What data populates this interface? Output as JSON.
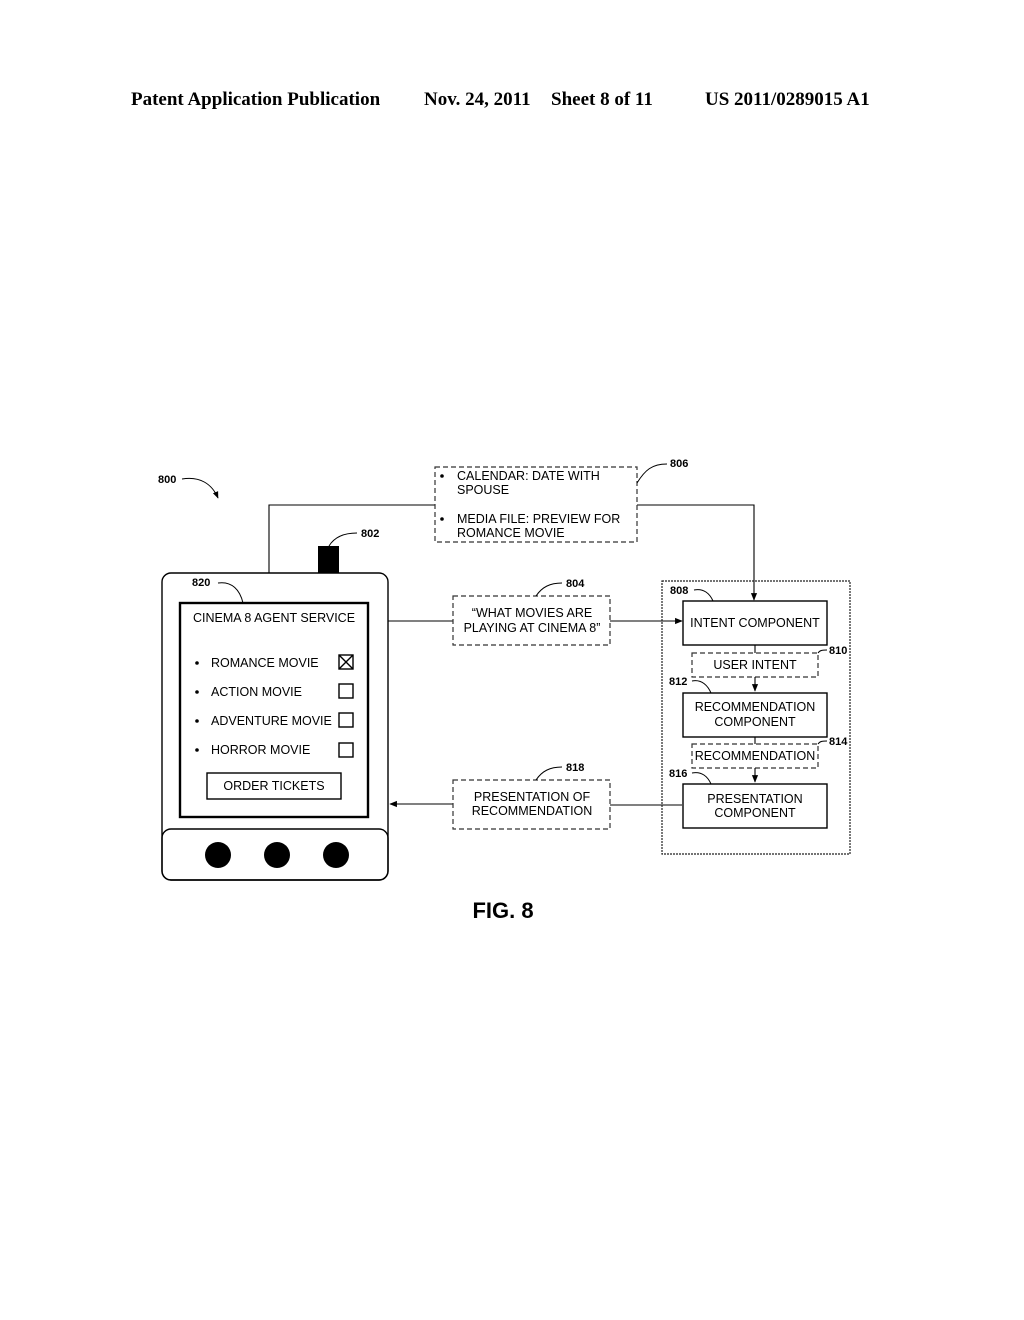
{
  "header": {
    "left": "Patent Application Publication",
    "date": "Nov. 24, 2011",
    "sheet": "Sheet 8 of 11",
    "number": "US 2011/0289015 A1"
  },
  "figure": {
    "caption": "FIG. 8",
    "system_ref": "800",
    "sensor": {
      "ref": "802"
    },
    "device": {
      "screen_ref": "820",
      "screen_title": "CINEMA 8 AGENT SERVICE",
      "options": [
        {
          "label": "ROMANCE MOVIE",
          "checked": true
        },
        {
          "label": "ACTION MOVIE",
          "checked": false
        },
        {
          "label": "ADVENTURE MOVIE",
          "checked": false
        },
        {
          "label": "HORROR MOVIE",
          "checked": false
        }
      ],
      "order_button": "ORDER TICKETS",
      "hardware_buttons": 3
    },
    "context_box": {
      "ref": "806",
      "items": [
        [
          "CALENDAR: DATE WITH",
          "SPOUSE"
        ],
        [
          "MEDIA FILE: PREVIEW FOR",
          "ROMANCE MOVIE"
        ]
      ]
    },
    "query_box": {
      "ref": "804",
      "lines": [
        "“WHAT MOVIES ARE",
        "PLAYING AT CINEMA 8”"
      ]
    },
    "presentation_box": {
      "ref": "818",
      "lines": [
        "PRESENTATION OF",
        "RECOMMENDATION"
      ]
    },
    "components": {
      "intent": {
        "ref": "808",
        "lines": [
          "INTENT COMPONENT"
        ]
      },
      "user_intent": {
        "ref": "810",
        "lines": [
          "USER INTENT"
        ]
      },
      "recommendation_component": {
        "ref": "812",
        "lines": [
          "RECOMMENDATION",
          "COMPONENT"
        ]
      },
      "recommendation": {
        "ref": "814",
        "lines": [
          "RECOMMENDATION"
        ]
      },
      "presentation_component": {
        "ref": "816",
        "lines": [
          "PRESENTATION",
          "COMPONENT"
        ]
      }
    }
  }
}
